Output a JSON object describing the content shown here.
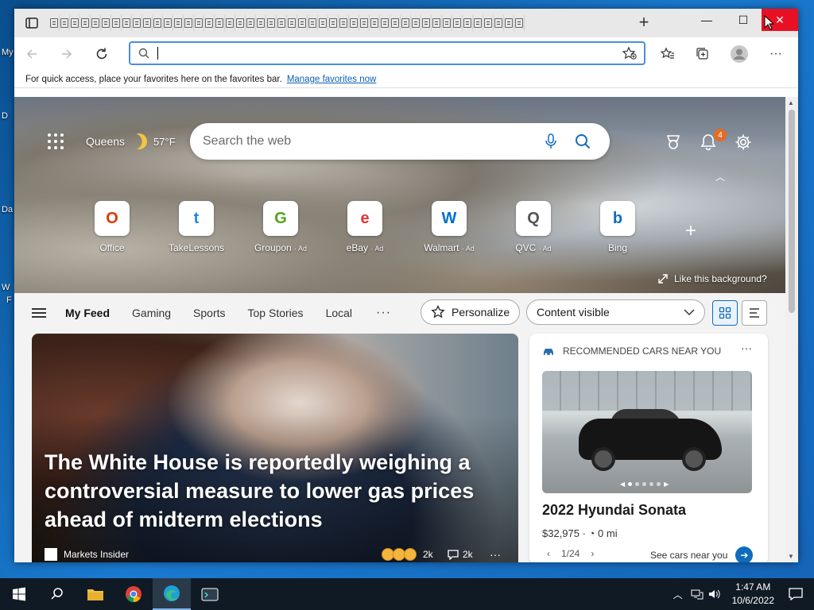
{
  "desktop": {
    "labels": [
      "My",
      "D",
      "Da",
      "W",
      "F"
    ]
  },
  "window": {
    "minimize_glyph": "—",
    "maximize_glyph": "☐",
    "close_glyph": "✕",
    "new_tab_glyph": "+"
  },
  "tabs": {
    "count": 46
  },
  "toolbar": {
    "address_value": "",
    "more_glyph": "···"
  },
  "favorites_bar": {
    "message": "For quick access, place your favorites here on the favorites bar.",
    "link": "Manage favorites now"
  },
  "hero": {
    "location": "Queens",
    "temperature": "57°F",
    "search_placeholder": "Search the web",
    "notification_count": "4",
    "like_background": "Like this background?",
    "quick_links": [
      {
        "label": "Office",
        "ad": "",
        "icon": "office-icon"
      },
      {
        "label": "TakeLessons",
        "ad": "",
        "icon": "takelessons-icon"
      },
      {
        "label": "Groupon",
        "ad": "· Ad",
        "icon": "groupon-icon"
      },
      {
        "label": "eBay",
        "ad": "· Ad",
        "icon": "ebay-icon"
      },
      {
        "label": "Walmart",
        "ad": "· Ad",
        "icon": "walmart-icon"
      },
      {
        "label": "QVC",
        "ad": "· Ad",
        "icon": "qvc-icon"
      },
      {
        "label": "Bing",
        "ad": "",
        "icon": "bing-icon"
      }
    ]
  },
  "feed_nav": {
    "tabs": [
      "My Feed",
      "Gaming",
      "Sports",
      "Top Stories",
      "Local"
    ],
    "more": "···",
    "personalize": "Personalize",
    "content_visibility": "Content visible"
  },
  "article": {
    "title": "The White House is reportedly weighing a controversial measure to lower gas prices ahead of midterm elections",
    "source": "Markets Insider",
    "reactions": "2k",
    "comments": "2k",
    "more": "···"
  },
  "card": {
    "header": "RECOMMENDED CARS NEAR YOU",
    "more": "···",
    "car_name": "2022 Hyundai Sonata",
    "price": "$32,975",
    "mileage": "0 mi",
    "pager": "1/24",
    "cta": "See cars near you"
  },
  "taskbar": {
    "time": "1:47 AM",
    "date": "10/6/2022"
  },
  "colors": {
    "accent": "#0f6cbd",
    "close": "#e81123",
    "badge": "#e36c25",
    "taskbar": "#101a24"
  }
}
